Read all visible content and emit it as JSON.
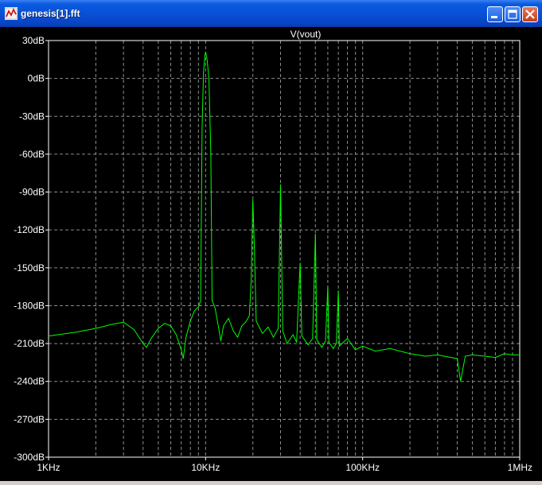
{
  "window": {
    "title": "genesis[1].fft",
    "icon": "waveform-icon",
    "controls": [
      "minimize-icon",
      "maximize-icon",
      "close-icon"
    ]
  },
  "colors": {
    "background": "#000000",
    "trace": "#00ff00",
    "grid": "#8c8c8c",
    "axis_text": "#ffffff"
  },
  "chart_data": {
    "type": "line",
    "title": "",
    "xlabel": "",
    "ylabel": "",
    "x_scale": "log",
    "xlim": [
      1000,
      1000000
    ],
    "ylim": [
      -300,
      30
    ],
    "grid": true,
    "legend": "top-center",
    "y_ticks": [
      30,
      0,
      -30,
      -60,
      -90,
      -120,
      -150,
      -180,
      -210,
      -240,
      -270,
      -300
    ],
    "y_tick_labels": [
      "30dB",
      "0dB",
      "-30dB",
      "-60dB",
      "-90dB",
      "-120dB",
      "-150dB",
      "-180dB",
      "-210dB",
      "-240dB",
      "-270dB",
      "-300dB"
    ],
    "x_ticks": [
      1000,
      10000,
      100000,
      1000000
    ],
    "x_tick_labels": [
      "1KHz",
      "10KHz",
      "100KHz",
      "1MHz"
    ],
    "series": [
      {
        "name": "V(vout)",
        "color": "#00ff00",
        "points": [
          [
            1000,
            -204
          ],
          [
            1500,
            -201
          ],
          [
            2000,
            -198
          ],
          [
            2500,
            -195
          ],
          [
            3000,
            -193
          ],
          [
            3500,
            -199
          ],
          [
            4000,
            -210
          ],
          [
            4200,
            -213
          ],
          [
            4500,
            -206
          ],
          [
            5000,
            -198
          ],
          [
            5500,
            -194
          ],
          [
            6000,
            -196
          ],
          [
            6500,
            -203
          ],
          [
            7000,
            -215
          ],
          [
            7200,
            -222
          ],
          [
            7500,
            -205
          ],
          [
            8000,
            -192
          ],
          [
            8500,
            -184
          ],
          [
            9000,
            -181
          ],
          [
            9300,
            -176
          ],
          [
            9500,
            -40
          ],
          [
            9700,
            5
          ],
          [
            9900,
            18
          ],
          [
            10000,
            21
          ],
          [
            10200,
            16
          ],
          [
            10500,
            0
          ],
          [
            10800,
            -60
          ],
          [
            11000,
            -176
          ],
          [
            11500,
            -182
          ],
          [
            12000,
            -195
          ],
          [
            12500,
            -208
          ],
          [
            13000,
            -196
          ],
          [
            14000,
            -190
          ],
          [
            15000,
            -200
          ],
          [
            16000,
            -205
          ],
          [
            17000,
            -196
          ],
          [
            18000,
            -193
          ],
          [
            19000,
            -188
          ],
          [
            19500,
            -160
          ],
          [
            20000,
            -96
          ],
          [
            20500,
            -140
          ],
          [
            21000,
            -192
          ],
          [
            23000,
            -202
          ],
          [
            25000,
            -197
          ],
          [
            27000,
            -205
          ],
          [
            29000,
            -198
          ],
          [
            30000,
            -84
          ],
          [
            31000,
            -200
          ],
          [
            33000,
            -210
          ],
          [
            36000,
            -203
          ],
          [
            38000,
            -209
          ],
          [
            40000,
            -146
          ],
          [
            41000,
            -204
          ],
          [
            45000,
            -211
          ],
          [
            48000,
            -206
          ],
          [
            50000,
            -123
          ],
          [
            51000,
            -207
          ],
          [
            55000,
            -213
          ],
          [
            58000,
            -208
          ],
          [
            60000,
            -165
          ],
          [
            61000,
            -209
          ],
          [
            65000,
            -214
          ],
          [
            68000,
            -210
          ],
          [
            70000,
            -168
          ],
          [
            71000,
            -212
          ],
          [
            80000,
            -206
          ],
          [
            90000,
            -215
          ],
          [
            100000,
            -212
          ],
          [
            120000,
            -216
          ],
          [
            150000,
            -214
          ],
          [
            200000,
            -218
          ],
          [
            250000,
            -220
          ],
          [
            300000,
            -219
          ],
          [
            400000,
            -222
          ],
          [
            420000,
            -240
          ],
          [
            450000,
            -220
          ],
          [
            500000,
            -219
          ],
          [
            600000,
            -220
          ],
          [
            700000,
            -221
          ],
          [
            800000,
            -218
          ],
          [
            900000,
            -219
          ],
          [
            1000000,
            -219
          ]
        ]
      }
    ]
  }
}
